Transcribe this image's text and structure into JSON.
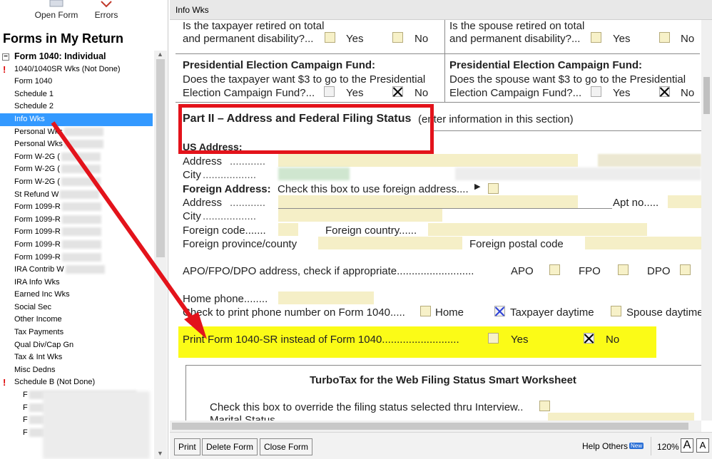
{
  "toolbar": {
    "open_form": "Open Form",
    "errors": "Errors"
  },
  "sidebar": {
    "title": "Forms in My Return",
    "root": "Form 1040:  Individual",
    "items": [
      {
        "label": "1040/1040SR Wks (Not Done)",
        "flag": "!"
      },
      {
        "label": "Form 1040"
      },
      {
        "label": "Schedule 1"
      },
      {
        "label": "Schedule 2"
      },
      {
        "label": "Info Wks",
        "selected": true
      },
      {
        "label": "Personal Wks"
      },
      {
        "label": "Personal Wks"
      },
      {
        "label": "Form W-2G ("
      },
      {
        "label": "Form W-2G ("
      },
      {
        "label": "Form W-2G ("
      },
      {
        "label": "St Refund W"
      },
      {
        "label": "Form 1099-R"
      },
      {
        "label": "Form 1099-R"
      },
      {
        "label": "Form 1099-R"
      },
      {
        "label": "Form 1099-R"
      },
      {
        "label": "Form 1099-R"
      },
      {
        "label": "IRA Contrib W"
      },
      {
        "label": "IRA Info Wks"
      },
      {
        "label": "Earned Inc Wks"
      },
      {
        "label": "Social Sec"
      },
      {
        "label": "Other Income"
      },
      {
        "label": "Tax Payments"
      },
      {
        "label": "Qual Div/Cap Gn"
      },
      {
        "label": "Tax & Int Wks"
      },
      {
        "label": "Misc Dedns"
      },
      {
        "label": "Schedule B (Not Done)",
        "flag": "!"
      },
      {
        "label": "F"
      },
      {
        "label": "F"
      },
      {
        "label": "F"
      },
      {
        "label": "F"
      }
    ]
  },
  "tab": {
    "title": "Info Wks"
  },
  "form": {
    "tp_retired_1": "Is the taxpayer retired on total",
    "tp_retired_2": "and permanent disability?...",
    "sp_retired_1": "Is the spouse retired on total",
    "sp_retired_2": "and permanent disability?...",
    "yes": "Yes",
    "no": "No",
    "pecf_title": "Presidential Election Campaign Fund:",
    "pecf_tp_1": "Does the taxpayer want $3 to go to the Presidential",
    "pecf_sp_1": "Does the spouse want $3 to go to the Presidential",
    "pecf_2": "Election Campaign Fund?...",
    "part2_title": "Part II – Address and Federal Filing Status",
    "part2_note": "(enter information in this section)",
    "us_address": "US Address:",
    "address": "Address",
    "city": "City",
    "foreign_address": "Foreign Address:",
    "foreign_check": "Check this box to use foreign address....",
    "apt_no": "Apt no.....",
    "foreign_code": "Foreign code.......",
    "foreign_country": "Foreign country......",
    "foreign_province": "Foreign province/county",
    "foreign_postal": "Foreign postal code",
    "apo_line": "APO/FPO/DPO address, check if appropriate..........................",
    "apo": "APO",
    "fpo": "FPO",
    "dpo": "DPO",
    "home_phone": "Home phone........",
    "print_phone": "Check to print phone number on Form 1040.....",
    "home": "Home",
    "taxpayer_daytime": "Taxpayer daytime",
    "spouse_daytime": "Spouse daytime",
    "print_1040sr": "Print Form 1040-SR instead of Form 1040..........................",
    "ws_title": "TurboTax for the Web Filing Status Smart Worksheet",
    "override": "Check this box to override the filing status selected thru Interview..",
    "marital": "Marital Status"
  },
  "footer": {
    "print": "Print",
    "delete_form": "Delete Form",
    "close_form": "Close Form",
    "help_others": "Help Others",
    "new_badge": "New",
    "zoom": "120%",
    "font_a": "A"
  },
  "colors": {
    "annotation_red": "#e3131b",
    "highlight_yellow": "#fbfb17",
    "field_fill": "#f5efc7",
    "selection_blue": "#3399ff"
  }
}
